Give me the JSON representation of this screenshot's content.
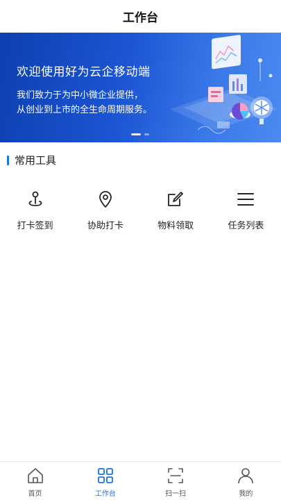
{
  "header": {
    "title": "工作台"
  },
  "banner": {
    "headline": "欢迎使用好为云企移动端",
    "line1": "我们致力于为中小微企业提供，",
    "line2": "从创业到上市的全生命周期服务。",
    "slide_count": 2,
    "active_slide": 1
  },
  "section": {
    "title": "常用工具"
  },
  "tools": [
    {
      "label": "打卡签到",
      "icon": "map-pin-checkin-icon"
    },
    {
      "label": "协助打卡",
      "icon": "location-pin-icon"
    },
    {
      "label": "物料领取",
      "icon": "edit-icon"
    },
    {
      "label": "任务列表",
      "icon": "list-icon"
    }
  ],
  "tabbar": [
    {
      "label": "首页",
      "icon": "home-icon"
    },
    {
      "label": "工作台",
      "icon": "grid-icon",
      "active": true
    },
    {
      "label": "扫一扫",
      "icon": "scan-icon"
    },
    {
      "label": "我的",
      "icon": "user-icon"
    }
  ],
  "colors": {
    "accent": "#1a73e8",
    "banner_start": "#0d3fb0",
    "banner_end": "#4b8af0"
  }
}
